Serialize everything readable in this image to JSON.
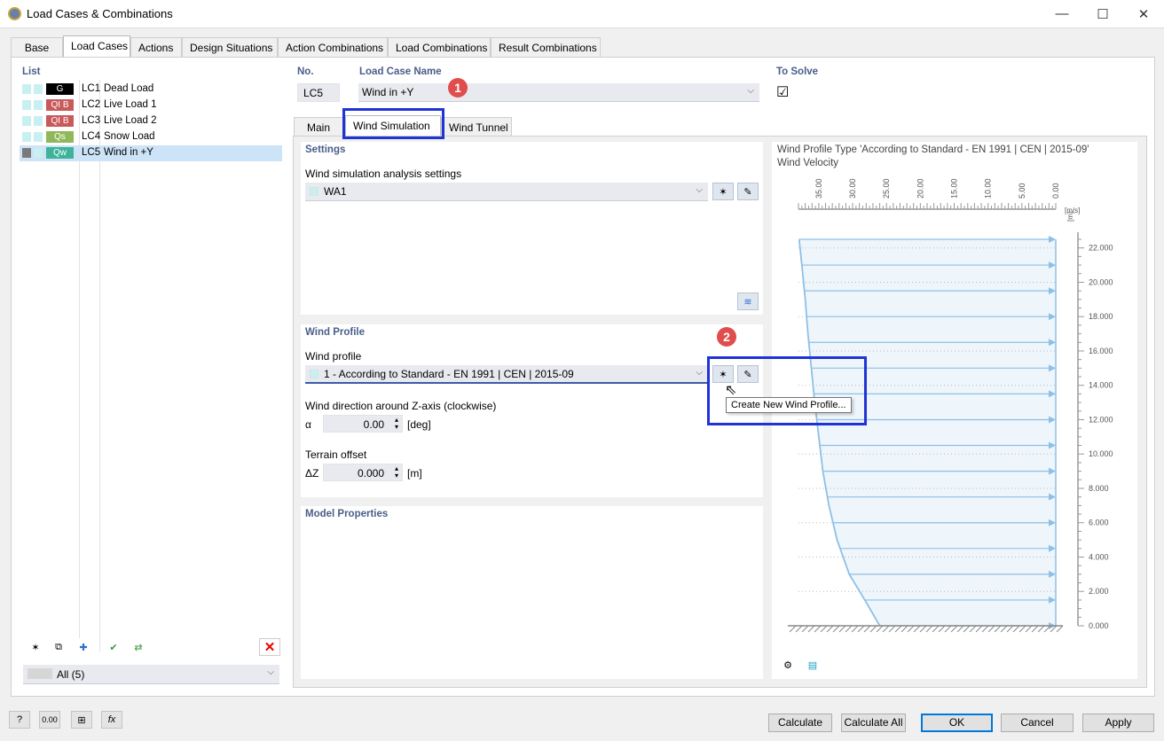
{
  "window": {
    "title": "Load Cases & Combinations",
    "minimize": "—",
    "maximize": "☐",
    "close": "✕"
  },
  "tabs": [
    "Base",
    "Load Cases",
    "Actions",
    "Design Situations",
    "Action Combinations",
    "Load Combinations",
    "Result Combinations"
  ],
  "list": {
    "heading": "List",
    "items": [
      {
        "code": "G",
        "id": "LC1",
        "name": "Dead Load",
        "color": "#000000"
      },
      {
        "code": "QI B",
        "id": "LC2",
        "name": "Live Load 1",
        "color": "#c85a5a"
      },
      {
        "code": "QI B",
        "id": "LC3",
        "name": "Live Load 2",
        "color": "#c85a5a"
      },
      {
        "code": "Qs",
        "id": "LC4",
        "name": "Snow Load",
        "color": "#8fb85a"
      },
      {
        "code": "Qw",
        "id": "LC5",
        "name": "Wind in +Y",
        "color": "#3fb39a"
      }
    ],
    "filter": "All (5)"
  },
  "header": {
    "no_label": "No.",
    "no_value": "LC5",
    "name_label": "Load Case Name",
    "name_value": "Wind in +Y",
    "solve_label": "To Solve",
    "solve_check": "☑"
  },
  "subtabs": [
    "Main",
    "Wind Simulation",
    "Wind Tunnel"
  ],
  "settings": {
    "heading": "Settings",
    "label": "Wind simulation analysis settings",
    "value": "WA1"
  },
  "wind_profile": {
    "heading": "Wind Profile",
    "label": "Wind profile",
    "value": "1 - According to Standard - EN 1991 | CEN | 2015-09",
    "dir_label": "Wind direction around Z-axis (clockwise)",
    "alpha_sym": "α",
    "alpha_value": "0.00",
    "alpha_unit": "[deg]",
    "terrain_label": "Terrain offset",
    "dz_sym": "ΔZ",
    "dz_value": "0.000",
    "dz_unit": "[m]",
    "tooltip": "Create New Wind Profile..."
  },
  "model": {
    "heading": "Model Properties"
  },
  "callouts": [
    "1",
    "2"
  ],
  "chart": {
    "title": "Wind Profile Type 'According to Standard - EN 1991 | CEN | 2015-09'",
    "subtitle": "Wind Velocity",
    "x_unit": "[m/s]",
    "y_unit": "[m]"
  },
  "chart_data": {
    "type": "line",
    "xticks": [
      "35.00",
      "30.00",
      "25.00",
      "20.00",
      "15.00",
      "10.00",
      "5.00",
      "0.00"
    ],
    "yticks": [
      "22.000",
      "20.000",
      "18.000",
      "16.000",
      "14.000",
      "12.000",
      "10.000",
      "8.000",
      "6.000",
      "4.000",
      "2.000",
      "0.000"
    ],
    "xlim": [
      0,
      38
    ],
    "ylim": [
      0,
      22.5
    ],
    "profile": [
      [
        26.0,
        0
      ],
      [
        28.2,
        1.5
      ],
      [
        30.5,
        3
      ],
      [
        32.3,
        5
      ],
      [
        33.5,
        7
      ],
      [
        34.4,
        9
      ],
      [
        35.0,
        11
      ],
      [
        35.6,
        13
      ],
      [
        36.1,
        15
      ],
      [
        36.6,
        17
      ],
      [
        37.0,
        19
      ],
      [
        37.5,
        21
      ],
      [
        37.9,
        22.5
      ]
    ],
    "arrow_heights": [
      0,
      1.5,
      3,
      4.5,
      6,
      7.5,
      9,
      10.5,
      12,
      13.5,
      15,
      16.5,
      18,
      19.5,
      21,
      22.5
    ]
  },
  "footer": {
    "calculate": "Calculate",
    "calculate_all": "Calculate All",
    "ok": "OK",
    "cancel": "Cancel",
    "apply": "Apply"
  }
}
